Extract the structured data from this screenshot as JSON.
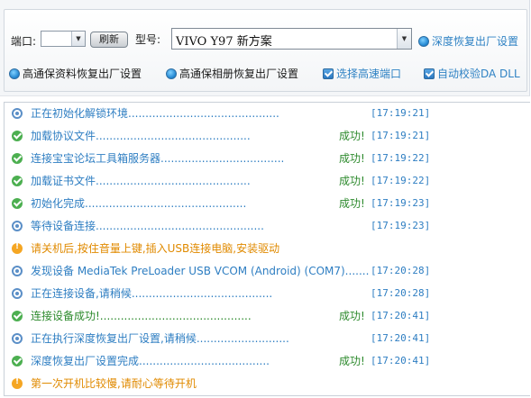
{
  "top": {
    "port_label": "端口:",
    "port_value": "",
    "refresh_label": "刷新",
    "model_label": "型号:",
    "model_value": "VIVO Y97 新方案",
    "deep_reset_label": "深度恢复出厂设置",
    "options": [
      {
        "label": "高通保资料恢复出厂设置",
        "type": "radio"
      },
      {
        "label": "高通保相册恢复出厂设置",
        "type": "radio"
      },
      {
        "label": "选择高速端口",
        "type": "checkbox",
        "checked": true
      },
      {
        "label": "自动校验DA DLL",
        "type": "checkbox",
        "checked": true
      }
    ]
  },
  "log": [
    {
      "status": "info",
      "text": "正在初始化解锁环境............................................",
      "result": "",
      "time": "[17:19:21]"
    },
    {
      "status": "ok",
      "text": "加载协议文件.............................................",
      "result": "成功!",
      "time": "[17:19:21]"
    },
    {
      "status": "ok",
      "text": "连接宝宝论坛工具箱服务器....................................",
      "result": "成功!",
      "time": "[17:19:22]"
    },
    {
      "status": "ok",
      "text": "加载证书文件.............................................",
      "result": "成功!",
      "time": "[17:19:22]"
    },
    {
      "status": "ok",
      "text": "初始化完成...............................................",
      "result": "成功!",
      "time": "[17:19:23]"
    },
    {
      "status": "info",
      "text": "等待设备连接.................................................",
      "result": "",
      "time": "[17:19:23]"
    },
    {
      "status": "warn",
      "text": "请关机后,按住音量上键,插入USB连接电脑,安装驱动",
      "result": "",
      "time": ""
    },
    {
      "status": "info",
      "text": "发现设备 MediaTek PreLoader USB VCOM (Android) (COM7).......",
      "result": "",
      "time": "[17:20:28]"
    },
    {
      "status": "info",
      "text": "正在连接设备,请稍候.........................................",
      "result": "",
      "time": "[17:20:28]"
    },
    {
      "status": "ok",
      "text": "连接设备成功!............................................",
      "result": "成功!",
      "time": "[17:20:41]"
    },
    {
      "status": "info",
      "text": "正在执行深度恢复出厂设置,请稍候...........................",
      "result": "",
      "time": "[17:20:41]"
    },
    {
      "status": "ok",
      "text": "深度恢复出厂设置完成......................................",
      "result": "成功!",
      "time": "[17:20:41]"
    },
    {
      "status": "warn",
      "text": "第一次开机比较慢,请耐心等待开机",
      "result": "",
      "time": ""
    }
  ]
}
